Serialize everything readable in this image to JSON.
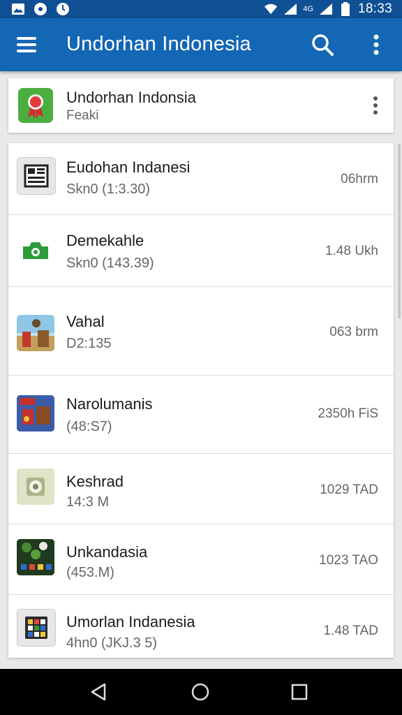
{
  "status_bar": {
    "time": "18:33",
    "network_label": "4G",
    "icons": [
      "photo-icon",
      "circle-icon",
      "timer-icon",
      "wifi-icon",
      "signal-icon",
      "signal-icon",
      "battery-icon"
    ]
  },
  "app_bar": {
    "title": "Undorhan Indonesia",
    "menu_icon": "hamburger-menu-icon",
    "search_icon": "search-icon",
    "more_icon": "more-vertical-icon",
    "color": "#1467b4"
  },
  "header_card": {
    "title": "Undorhan Indonsia",
    "subtitle": "Feaki",
    "icon": "award-ribbon-icon"
  },
  "list": {
    "items": [
      {
        "name": "Eudohan Indanesi",
        "detail": "Skn0 (1:3.30)",
        "size": "06hrm",
        "icon": "news-app-icon"
      },
      {
        "name": "Demekahle",
        "detail": "Skn0 (143.39)",
        "size": "1.48 Ukh",
        "icon": "camera-icon"
      },
      {
        "name": "Vahal",
        "detail": "D2:135",
        "size": "063 brm",
        "icon": "game-scene-icon"
      },
      {
        "name": "Narolumanis",
        "detail": "(48:S7)",
        "size": "2350h FiS",
        "icon": "game-scene-icon"
      },
      {
        "name": "Keshrad",
        "detail": "14:3 M",
        "size": "1029 TAD",
        "icon": "safe-icon"
      },
      {
        "name": "Unkandasia",
        "detail": "(453.M)",
        "size": "1023 TAO",
        "icon": "game-scene-icon"
      },
      {
        "name": "Umorlan Indanesia",
        "detail": "4hn0 (JKJ.3 5)",
        "size": "1.48 TAD",
        "icon": "grid-apps-icon"
      }
    ]
  },
  "nav_bar": {
    "back_icon": "back-triangle-icon",
    "home_icon": "home-circle-icon",
    "recents_icon": "recents-square-icon"
  }
}
